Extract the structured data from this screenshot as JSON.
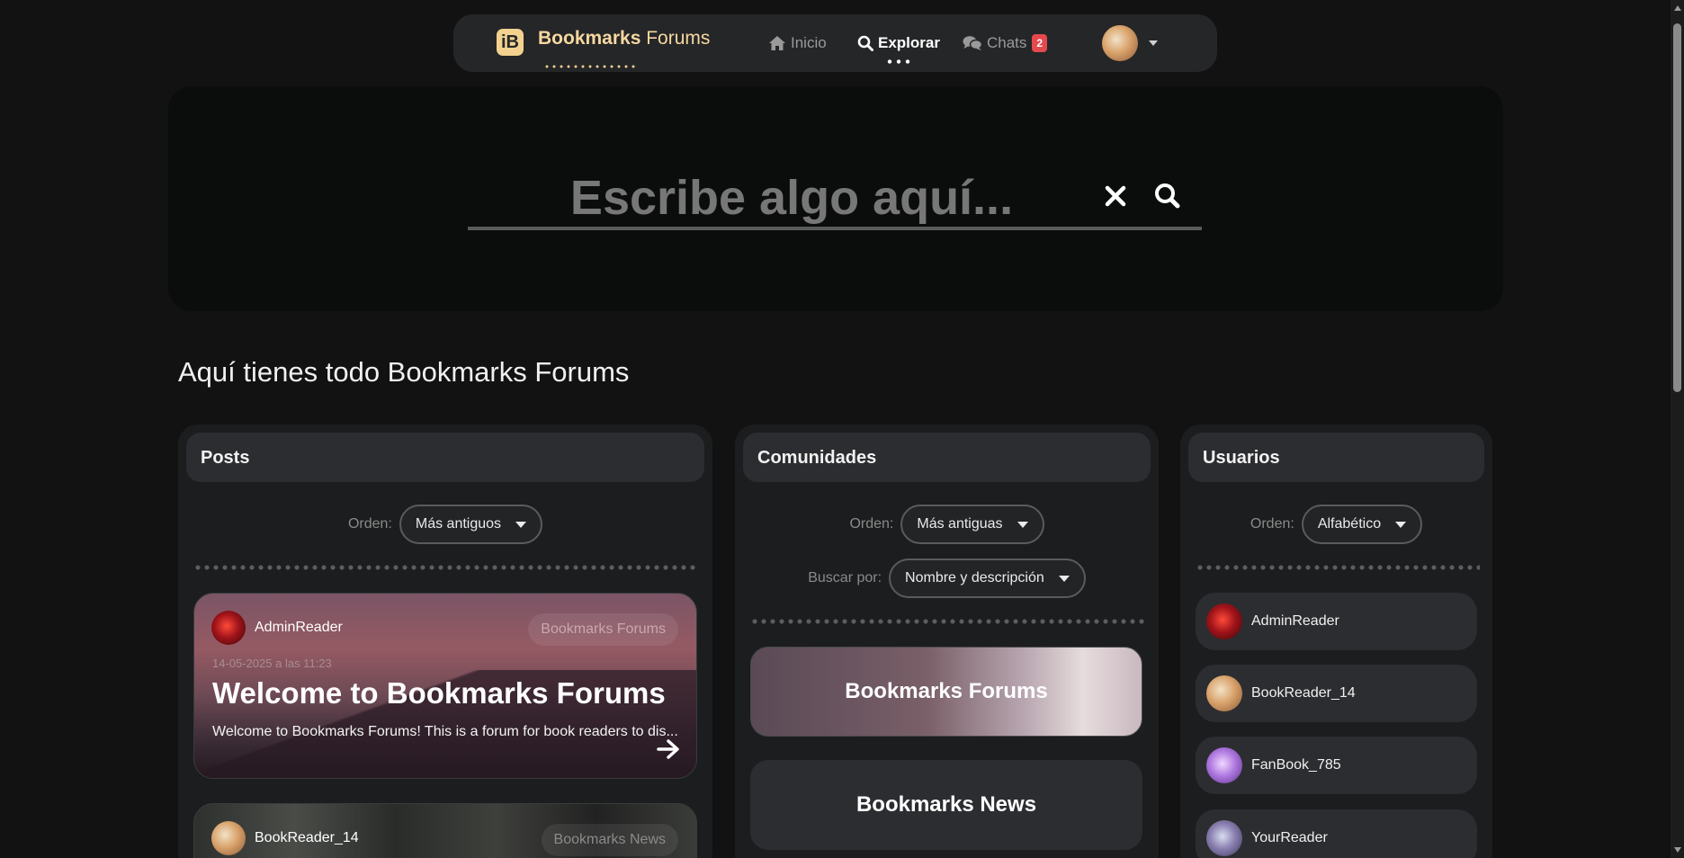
{
  "navbar": {
    "brand_logo": "iB",
    "brand_strong": "Bookmarks",
    "brand_light": "Forums",
    "links": {
      "inicio": "Inicio",
      "explorar": "Explorar",
      "chats": "Chats"
    },
    "chats_badge": "2"
  },
  "search": {
    "placeholder": "Escribe algo aquí..."
  },
  "section_title": "Aquí tienes todo Bookmarks Forums",
  "posts_panel": {
    "title": "Posts",
    "order_label": "Orden:",
    "order_value": "Más antiguos",
    "items": [
      {
        "author": "AdminReader",
        "community": "Bookmarks Forums",
        "date": "14-05-2025 a las 11:23",
        "title": "Welcome to Bookmarks Forums",
        "excerpt": "Welcome to Bookmarks Forums! This is a forum for book readers to dis..."
      },
      {
        "author": "BookReader_14",
        "community": "Bookmarks News"
      }
    ]
  },
  "communities_panel": {
    "title": "Comunidades",
    "order_label": "Orden:",
    "order_value": "Más antiguas",
    "search_by_label": "Buscar por:",
    "search_by_value": "Nombre y descripción",
    "items": [
      "Bookmarks Forums",
      "Bookmarks News"
    ]
  },
  "users_panel": {
    "title": "Usuarios",
    "order_label": "Orden:",
    "order_value": "Alfabético",
    "items": [
      "AdminReader",
      "BookReader_14",
      "FanBook_785",
      "YourReader"
    ]
  },
  "colors": {
    "background": "#121212",
    "brand": "#f3d28f",
    "badge": "#e5484d",
    "panel": "#1c1d1e",
    "card": "#2c2d30"
  }
}
